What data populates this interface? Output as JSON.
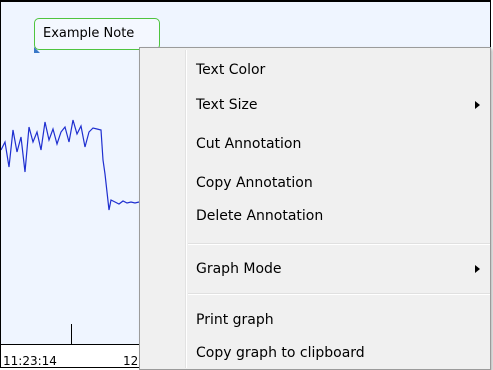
{
  "graph": {
    "note_text": "Example Note",
    "x_axis_ticks": [
      "11:23:14",
      "12"
    ],
    "line_color": "#1f2fd0",
    "background_color": "#eff5ff"
  },
  "context_menu": {
    "items": [
      {
        "label": "Text Color",
        "has_submenu": false
      },
      {
        "label": "Text Size",
        "has_submenu": true
      },
      {
        "label": "Cut Annotation",
        "has_submenu": false
      },
      {
        "label": "Copy Annotation",
        "has_submenu": false
      },
      {
        "label": "Delete Annotation",
        "has_submenu": false
      },
      {
        "label": "Graph Mode",
        "has_submenu": true
      },
      {
        "label": "Print graph",
        "has_submenu": false
      },
      {
        "label": "Copy graph to clipboard",
        "has_submenu": false
      }
    ]
  }
}
